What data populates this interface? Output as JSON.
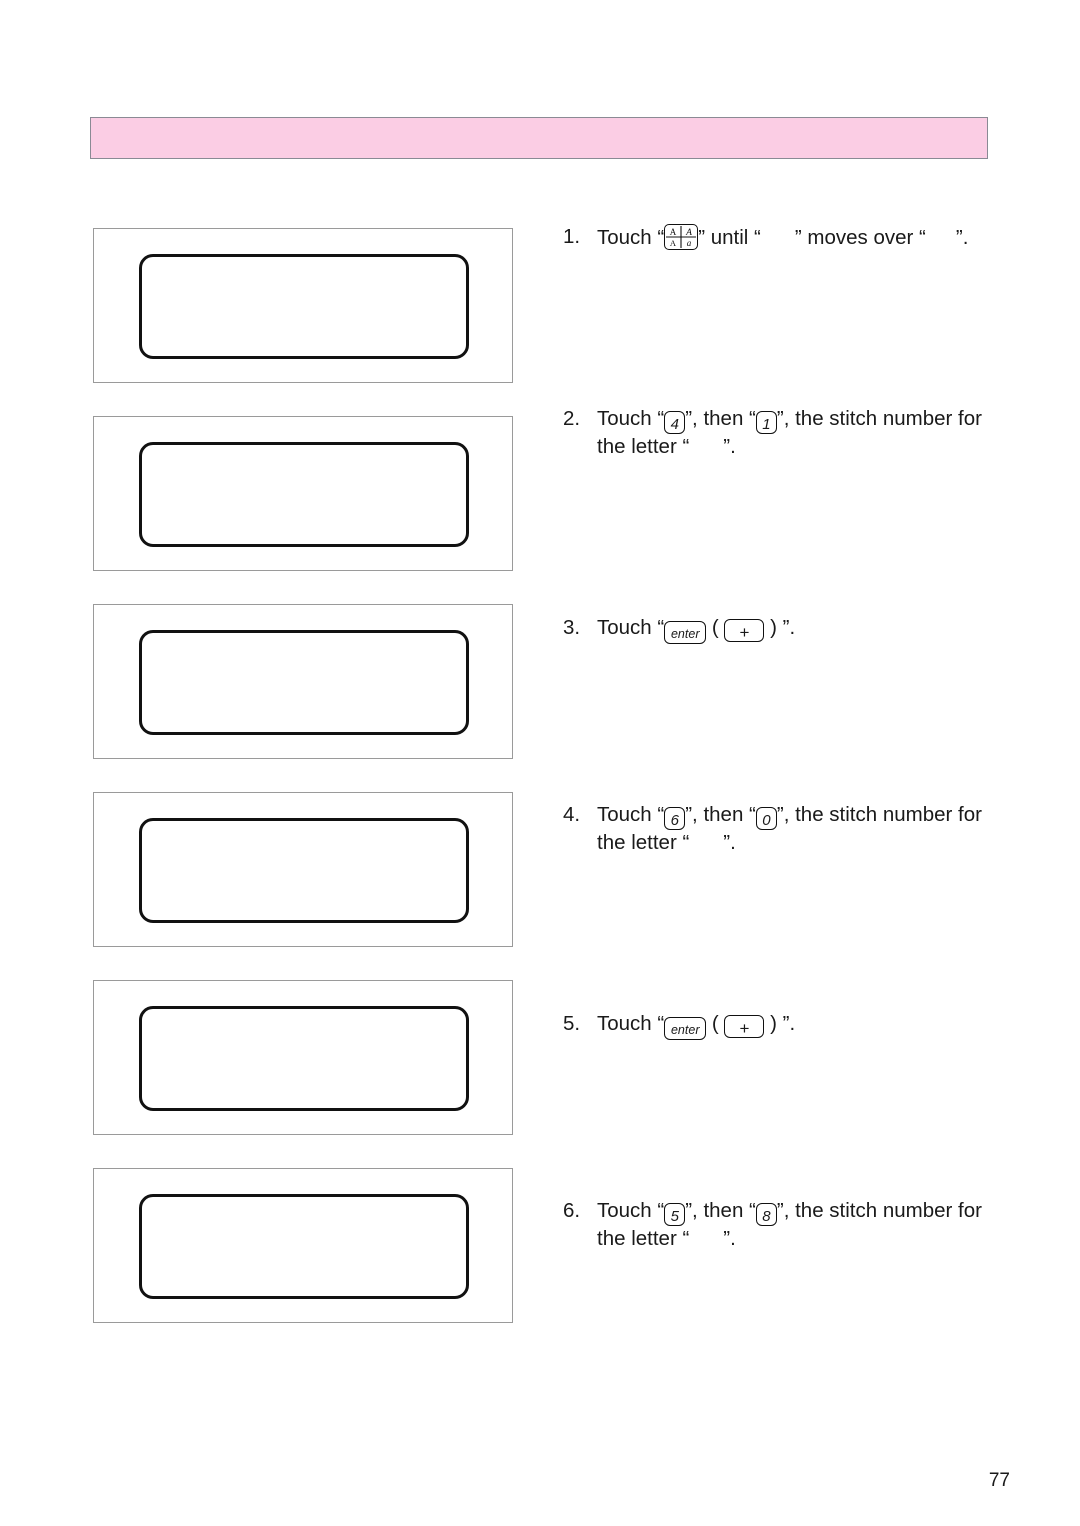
{
  "page": {
    "number": "77",
    "background_color": "#ffffff"
  },
  "header": {
    "banner_title": "",
    "fill_color": "#fbcde4",
    "border_color": "#8a8a94"
  },
  "illustrations": {
    "caption": "",
    "panels": [
      {
        "lcd_text": ""
      },
      {
        "lcd_text": ""
      },
      {
        "lcd_text": ""
      },
      {
        "lcd_text": ""
      },
      {
        "lcd_text": ""
      },
      {
        "lcd_text": ""
      }
    ]
  },
  "steps": [
    {
      "number": "1.",
      "pre": "Touch “",
      "key_1": "mode-icon",
      "mid_1": "” until “",
      "blank_1": "",
      "mid_2": "” moves over “",
      "blank_2": "",
      "post": "”."
    },
    {
      "number": "2.",
      "pre": "Touch “",
      "key_1": "4",
      "mid_1": "”, then “",
      "key_2": "1",
      "mid_2": "”, the stitch number for",
      "line2_pre": "the letter “",
      "blank_1": "",
      "post": "”."
    },
    {
      "number": "3.",
      "pre": "Touch “",
      "key_1": "enter",
      "mid_1": " ( ",
      "key_2": "+",
      "post": " ) ”."
    },
    {
      "number": "4.",
      "pre": "Touch “",
      "key_1": "6",
      "mid_1": "”, then “",
      "key_2": "0",
      "mid_2": "”, the stitch number for",
      "line2_pre": "the letter “",
      "blank_1": "",
      "post": "”."
    },
    {
      "number": "5.",
      "pre": "Touch “",
      "key_1": "enter",
      "mid_1": " ( ",
      "key_2": "+",
      "post": " ) ”."
    },
    {
      "number": "6.",
      "pre": "Touch “",
      "key_1": "5",
      "mid_1": "”, then “",
      "key_2": "8",
      "mid_2": "”, the stitch number for",
      "line2_pre": "the letter “",
      "blank_1": "",
      "post": "”."
    }
  ]
}
